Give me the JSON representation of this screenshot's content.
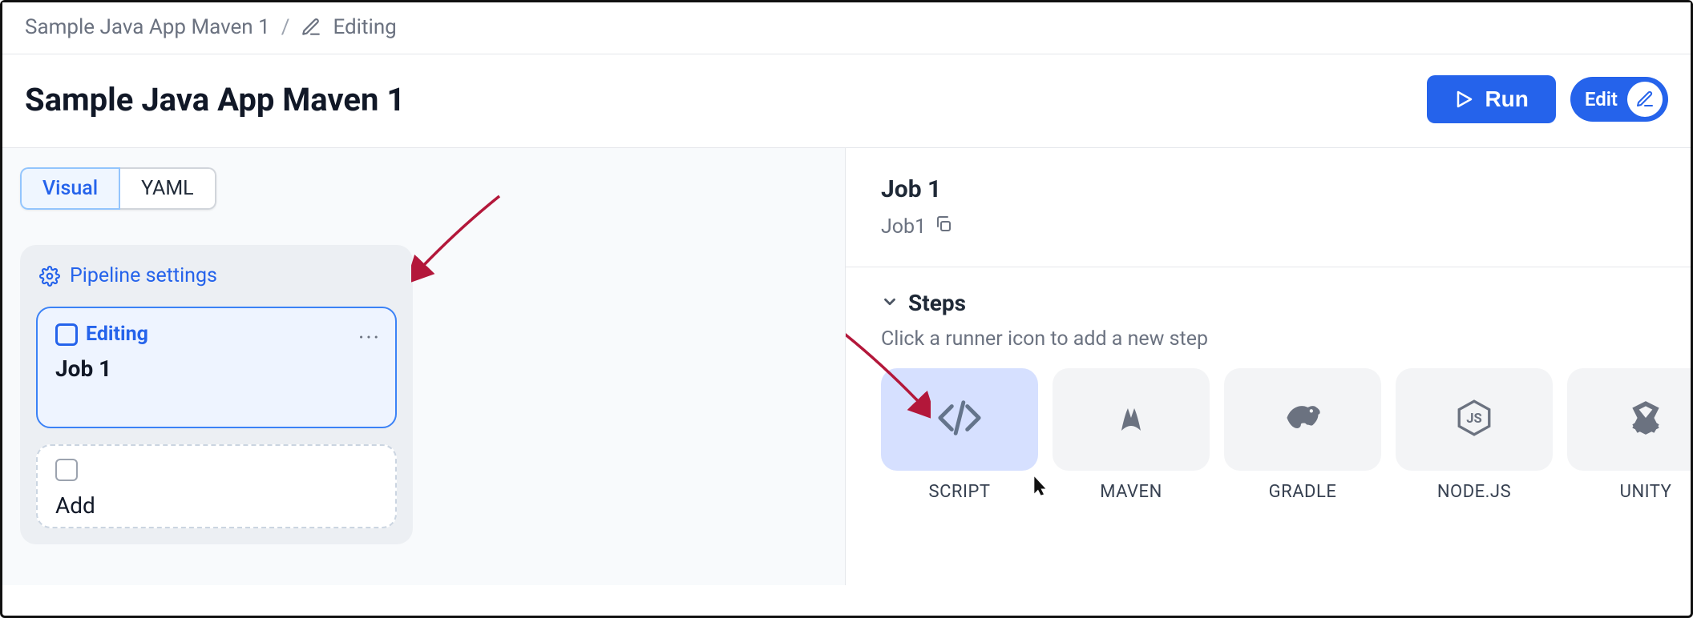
{
  "breadcrumb": {
    "project": "Sample Java App Maven 1",
    "status": "Editing"
  },
  "header": {
    "title": "Sample Java App Maven 1",
    "run_label": "Run",
    "edit_label": "Edit"
  },
  "left": {
    "tab_visual": "Visual",
    "tab_yaml": "YAML",
    "pipeline_settings": "Pipeline settings",
    "job": {
      "editing_badge": "Editing",
      "name": "Job 1"
    },
    "add_label": "Add"
  },
  "right": {
    "job_title": "Job 1",
    "job_id": "Job1",
    "steps_label": "Steps",
    "steps_hint": "Click a runner icon to add a new step",
    "runners": {
      "script": "SCRIPT",
      "maven": "MAVEN",
      "gradle": "GRADLE",
      "nodejs": "NODE.JS",
      "unity": "UNITY"
    }
  }
}
